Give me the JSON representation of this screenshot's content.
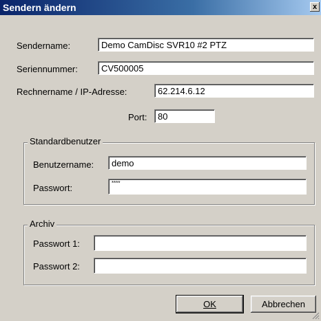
{
  "window": {
    "title": "Sendern ändern",
    "close_label": "x"
  },
  "fields": {
    "sendername": {
      "label": "Sendername:",
      "value": "Demo CamDisc SVR10 #2 PTZ"
    },
    "seriennummer": {
      "label": "Seriennummer:",
      "value": "CV500005"
    },
    "rechnername": {
      "label": "Rechnername / IP-Adresse:",
      "value": "62.214.6.12"
    },
    "port": {
      "label": "Port:",
      "value": "80"
    }
  },
  "standardbenutzer": {
    "legend": "Standardbenutzer",
    "benutzername": {
      "label": "Benutzername:",
      "value": "demo"
    },
    "passwort": {
      "label": "Passwort:",
      "value": "****"
    }
  },
  "archiv": {
    "legend": "Archiv",
    "passwort1": {
      "label": "Passwort 1:",
      "value": ""
    },
    "passwort2": {
      "label": "Passwort 2:",
      "value": ""
    }
  },
  "buttons": {
    "ok": "OK",
    "abbrechen": "Abbrechen"
  }
}
